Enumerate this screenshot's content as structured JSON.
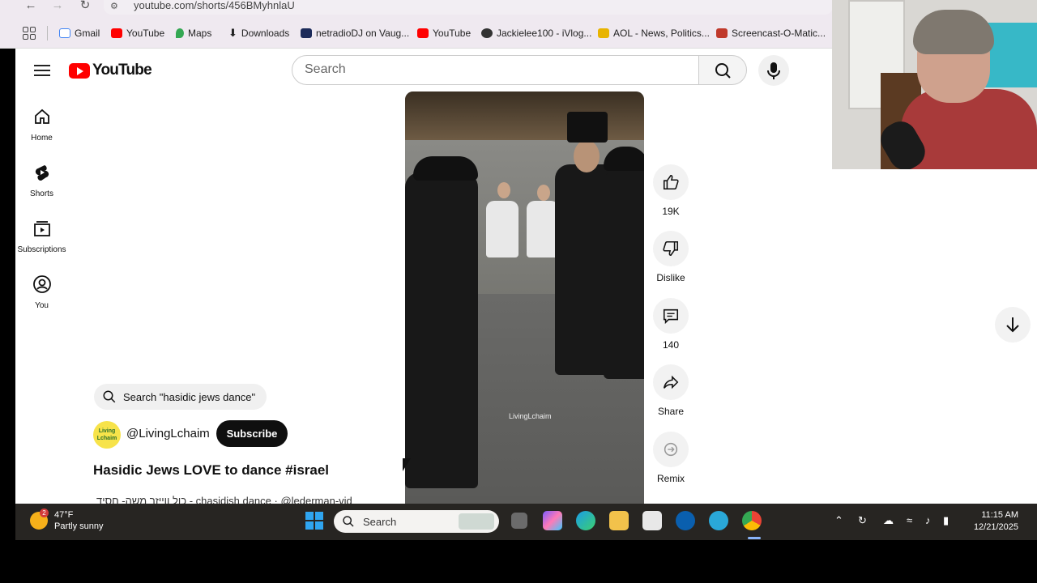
{
  "browser": {
    "url": "youtube.com/shorts/456BMyhnlaU",
    "bookmarks": [
      {
        "label": "Gmail",
        "color": "#4285f4"
      },
      {
        "label": "YouTube",
        "color": "#ff0000"
      },
      {
        "label": "Maps",
        "color": "#34a853"
      },
      {
        "label": "Downloads",
        "color": "#444444"
      },
      {
        "label": "netradioDJ on Vaug...",
        "color": "#1c2b5a"
      },
      {
        "label": "YouTube",
        "color": "#ff0000"
      },
      {
        "label": "Jackielee100 - iVlog...",
        "color": "#333333"
      },
      {
        "label": "AOL - News, Politics...",
        "color": "#e8b400"
      },
      {
        "label": "Screencast-O-Matic...",
        "color": "#c0392b"
      }
    ]
  },
  "youtube": {
    "logo_text": "YouTube",
    "search_placeholder": "Search",
    "sidebar": [
      {
        "label": "Home",
        "icon": "home-icon"
      },
      {
        "label": "Shorts",
        "icon": "shorts-icon"
      },
      {
        "label": "Subscriptions",
        "icon": "subscriptions-icon"
      },
      {
        "label": "You",
        "icon": "you-icon"
      }
    ],
    "short": {
      "watermark": "LivingLchaim",
      "search_chip": "Search \"hasidic jews dance\"",
      "avatar_text": "Living Lchaim",
      "channel": "@LivingLchaim",
      "subscribe_label": "Subscribe",
      "title": "Hasidic Jews LOVE to dance #israel",
      "description": "כול ווייזר משה- חסיד - chasidish dance · @lederman-vid"
    },
    "actions": [
      {
        "label": "19K",
        "icon": "like-icon"
      },
      {
        "label": "Dislike",
        "icon": "dislike-icon"
      },
      {
        "label": "140",
        "icon": "comment-icon"
      },
      {
        "label": "Share",
        "icon": "share-icon"
      },
      {
        "label": "Remix",
        "icon": "remix-icon"
      }
    ]
  },
  "taskbar": {
    "weather_temp": "47°F",
    "weather_desc": "Partly sunny",
    "weather_badge": "2",
    "search_label": "Search",
    "time": "11:15 AM",
    "date": "12/21/2025"
  }
}
